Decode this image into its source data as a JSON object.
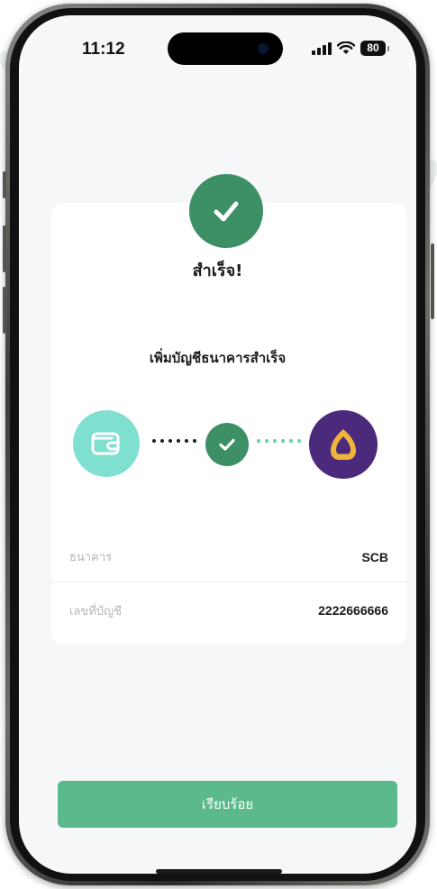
{
  "status_bar": {
    "time": "11:12",
    "battery": "80",
    "icons": [
      "signal-icon",
      "wifi-icon",
      "battery-icon"
    ]
  },
  "success": {
    "icon": "check-icon",
    "title": "สำเร็จ!",
    "subtitle": "เพิ่มบัญชีธนาคารสำเร็จ"
  },
  "connection": {
    "from_icon": "wallet-icon",
    "middle_icon": "check-icon",
    "to_icon": "scb-bank-logo-icon"
  },
  "details": [
    {
      "label": "ธนาคาร",
      "value": "SCB"
    },
    {
      "label": "เลขที่บัญชี",
      "value": "2222666666"
    }
  ],
  "actions": {
    "done_label": "เรียบร้อย"
  },
  "colors": {
    "success_green": "#3d8f66",
    "button_green": "#5bb98b",
    "wallet_teal": "#7fe0d0",
    "scb_purple": "#4b2a7b",
    "scb_gold": "#f0b43a"
  }
}
